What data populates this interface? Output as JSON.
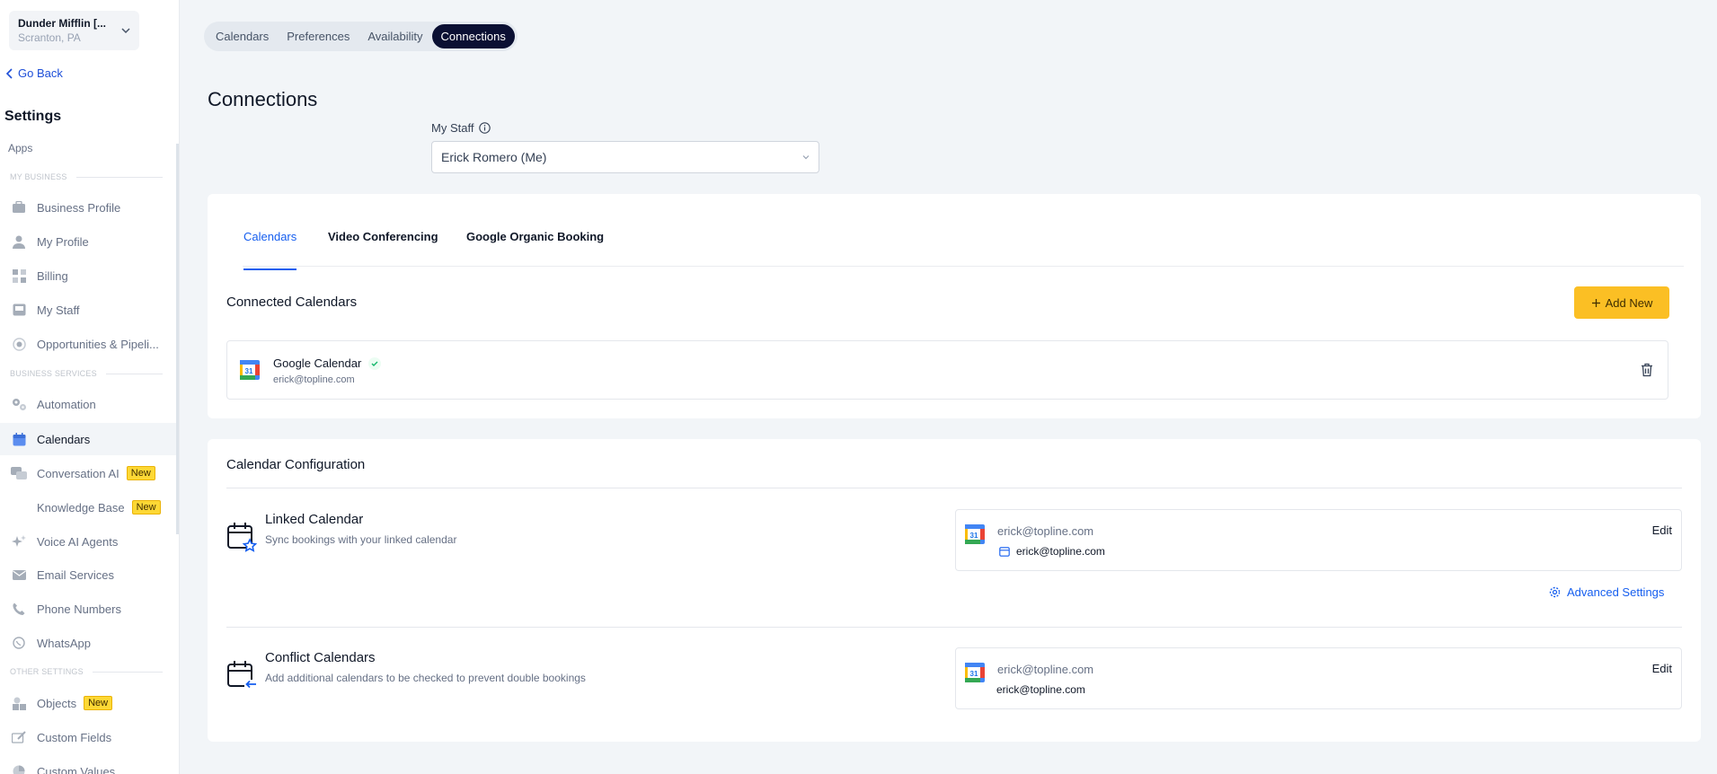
{
  "account": {
    "name": "Dunder Mifflin [...",
    "location": "Scranton, PA"
  },
  "sidebar": {
    "go_back": "Go Back",
    "title": "Settings",
    "apps": "Apps",
    "sections": {
      "my_business": "MY BUSINESS",
      "business_services": "BUSINESS SERVICES",
      "other_settings": "OTHER SETTINGS"
    },
    "items": [
      {
        "label": "Business Profile",
        "icon": "briefcase-icon"
      },
      {
        "label": "My Profile",
        "icon": "user-icon"
      },
      {
        "label": "Billing",
        "icon": "billing-grid-icon"
      },
      {
        "label": "My Staff",
        "icon": "inbox-icon"
      },
      {
        "label": "Opportunities & Pipeli...",
        "icon": "target-icon"
      },
      {
        "label": "Automation",
        "icon": "gears-icon"
      },
      {
        "label": "Calendars",
        "icon": "calendar-icon",
        "active": true
      },
      {
        "label": "Conversation AI",
        "icon": "chat-bubbles-icon",
        "badge": "New"
      },
      {
        "label": "Knowledge Base",
        "icon": "",
        "badge": "New"
      },
      {
        "label": "Voice AI Agents",
        "icon": "sparkle-icon"
      },
      {
        "label": "Email Services",
        "icon": "envelope-icon"
      },
      {
        "label": "Phone Numbers",
        "icon": "phone-icon"
      },
      {
        "label": "WhatsApp",
        "icon": "whatsapp-icon"
      },
      {
        "label": "Objects",
        "icon": "shapes-icon",
        "badge": "New"
      },
      {
        "label": "Custom Fields",
        "icon": "pencil-field-icon"
      },
      {
        "label": "Custom Values",
        "icon": "pie-icon"
      }
    ]
  },
  "top_tabs": [
    "Calendars",
    "Preferences",
    "Availability",
    "Connections"
  ],
  "top_tab_active": "Connections",
  "page_title": "Connections",
  "staff": {
    "label": "My Staff",
    "selected": "Erick Romero (Me)"
  },
  "inner_tabs": [
    "Calendars",
    "Video Conferencing",
    "Google Organic Booking"
  ],
  "inner_tab_active": "Calendars",
  "connected": {
    "title": "Connected Calendars",
    "add_new": "Add New",
    "items": [
      {
        "name": "Google Calendar",
        "email": "erick@topline.com",
        "status": "connected"
      }
    ]
  },
  "config": {
    "title": "Calendar Configuration",
    "linked": {
      "name": "Linked Calendar",
      "desc": "Sync bookings with your linked calendar",
      "account": "erick@topline.com",
      "calendar": "erick@topline.com",
      "edit": "Edit",
      "advanced": "Advanced Settings"
    },
    "conflict": {
      "name": "Conflict Calendars",
      "desc": "Add additional calendars to be checked to prevent double bookings",
      "account": "erick@topline.com",
      "calendar": "erick@topline.com",
      "edit": "Edit"
    }
  },
  "colors": {
    "accent": "#155eef",
    "cta": "#fbbf24",
    "active_tab": "#0b1033",
    "badge": "#fdd835"
  }
}
